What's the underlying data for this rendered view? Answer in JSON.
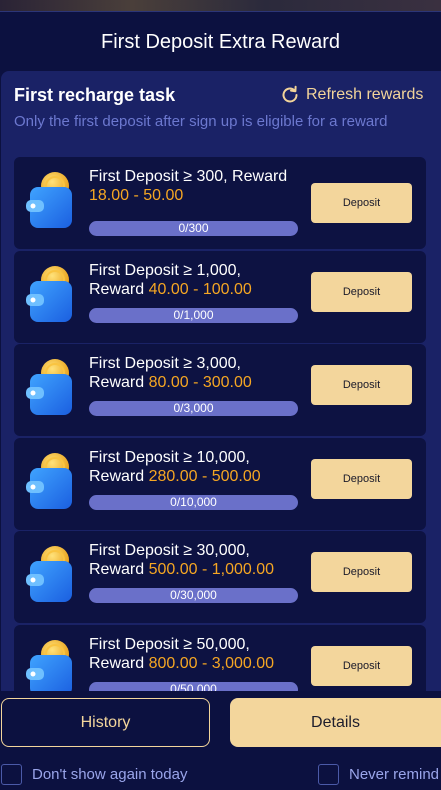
{
  "modal": {
    "title": "First Deposit Extra Reward"
  },
  "section": {
    "title": "First recharge task",
    "refresh_label": "Refresh rewards",
    "subtitle": "Only the first deposit after sign up is eligible for a reward"
  },
  "tasks": [
    {
      "line1": "First Deposit ≥ 300, Reward",
      "line2_prefix": "",
      "reward": "18.00 - 50.00",
      "progress": "0/300",
      "progress_fraction": 0,
      "button": "Deposit"
    },
    {
      "line1": "First Deposit ≥ 1,000,",
      "line2_prefix": "Reward ",
      "reward": "40.00 - 100.00",
      "progress": "0/1,000",
      "progress_fraction": 0,
      "button": "Deposit"
    },
    {
      "line1": "First Deposit ≥ 3,000,",
      "line2_prefix": "Reward ",
      "reward": "80.00 - 300.00",
      "progress": "0/3,000",
      "progress_fraction": 0,
      "button": "Deposit"
    },
    {
      "line1": "First Deposit ≥ 10,000,",
      "line2_prefix": "Reward ",
      "reward": "280.00 - 500.00",
      "progress": "0/10,000",
      "progress_fraction": 0,
      "button": "Deposit"
    },
    {
      "line1": "First Deposit ≥ 30,000,",
      "line2_prefix": "Reward ",
      "reward": "500.00 - 1,000.00",
      "progress": "0/30,000",
      "progress_fraction": 0,
      "button": "Deposit"
    },
    {
      "line1": "First Deposit ≥ 50,000,",
      "line2_prefix": "Reward ",
      "reward": "800.00 - 3,000.00",
      "progress": "0/50,000",
      "progress_fraction": 0,
      "button": "Deposit"
    }
  ],
  "footer": {
    "history_label": "History",
    "details_label": "Details",
    "dont_show_label": "Don't show again today",
    "never_remind_label": "Never remind"
  },
  "colors": {
    "accent_gold": "#f3d69c",
    "reward_orange": "#f5a623",
    "background": "#0c1140",
    "panel": "#1a2266"
  }
}
